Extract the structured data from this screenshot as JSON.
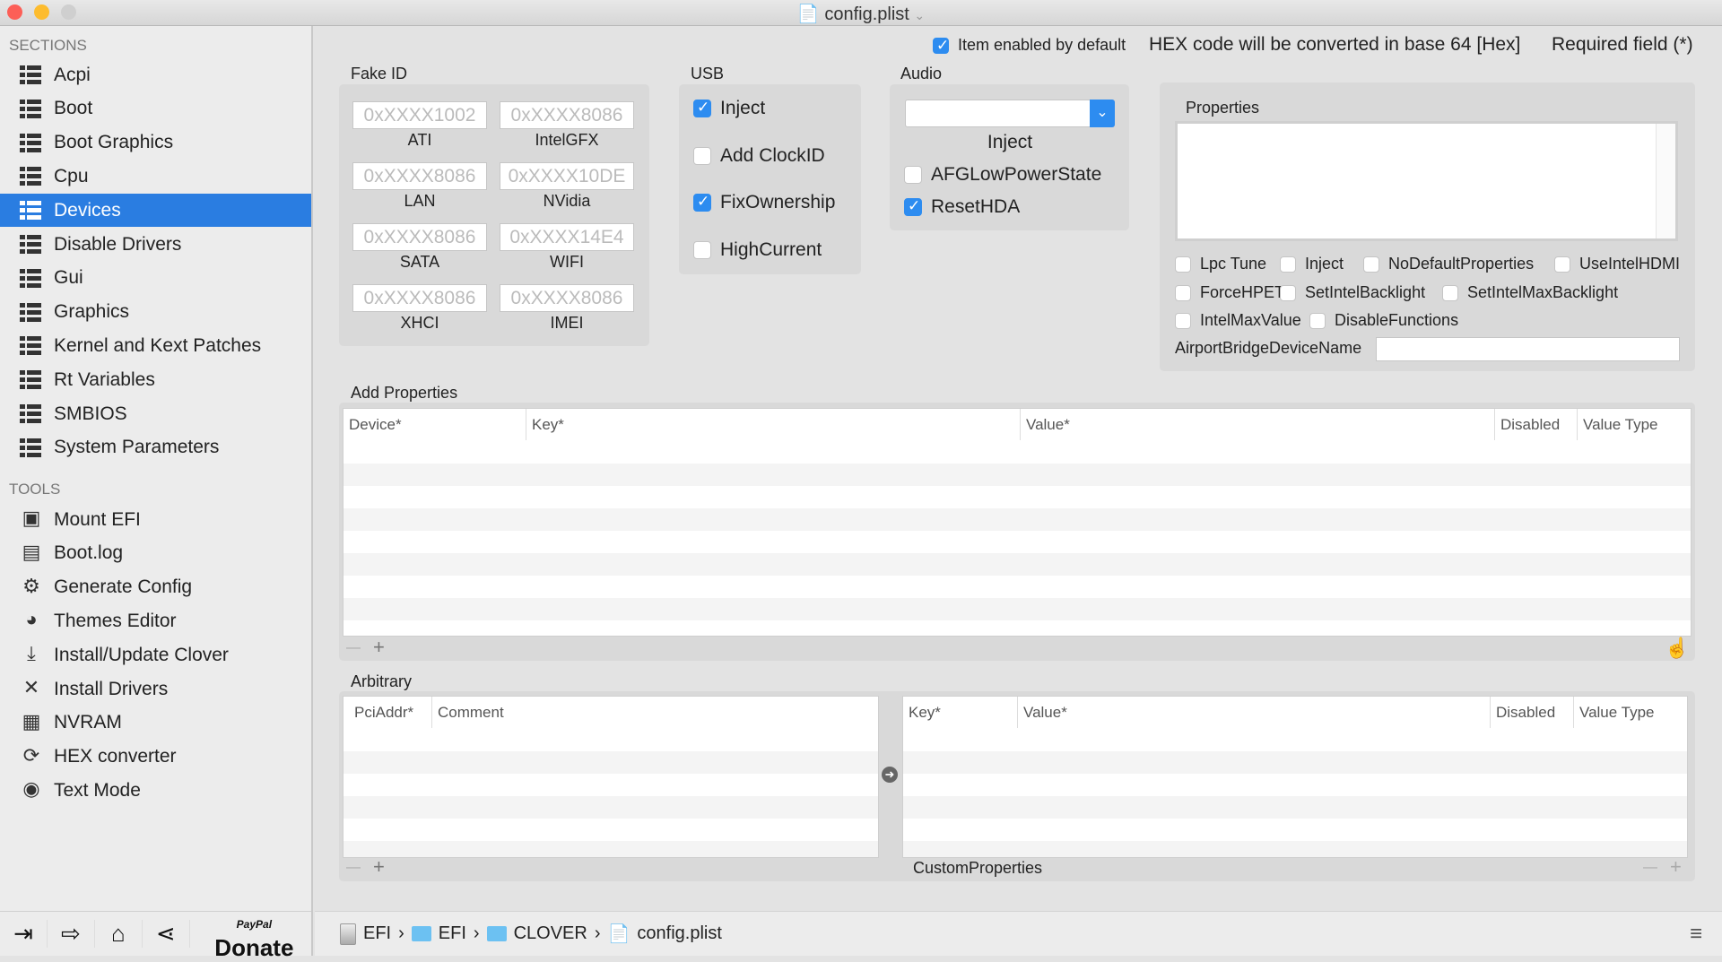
{
  "window": {
    "title": "config.plist"
  },
  "sidebar": {
    "sections_label": "SECTIONS",
    "sections": [
      "Acpi",
      "Boot",
      "Boot Graphics",
      "Cpu",
      "Devices",
      "Disable Drivers",
      "Gui",
      "Graphics",
      "Kernel and Kext Patches",
      "Rt Variables",
      "SMBIOS",
      "System Parameters"
    ],
    "selected": "Devices",
    "tools_label": "TOOLS",
    "tools": [
      {
        "label": "Mount EFI",
        "icon": "disk-icon",
        "g": "▣"
      },
      {
        "label": "Boot.log",
        "icon": "log-icon",
        "g": "▤"
      },
      {
        "label": "Generate Config",
        "icon": "gear-icon",
        "g": "⚙"
      },
      {
        "label": "Themes Editor",
        "icon": "palette-icon",
        "g": "◕"
      },
      {
        "label": "Install/Update Clover",
        "icon": "download-icon",
        "g": "⤓"
      },
      {
        "label": "Install Drivers",
        "icon": "tools-icon",
        "g": "✕"
      },
      {
        "label": "NVRAM",
        "icon": "chip-icon",
        "g": "▦"
      },
      {
        "label": "HEX converter",
        "icon": "refresh-icon",
        "g": "⟳"
      },
      {
        "label": "Text Mode",
        "icon": "eye-icon",
        "g": "◉"
      }
    ],
    "donate": "Donate",
    "paypal": "PayPal"
  },
  "header": {
    "item_enabled": "Item enabled by default",
    "hex_note": "HEX code will be converted in base 64 [Hex]",
    "required": "Required field (*)"
  },
  "fake_id": {
    "title": "Fake ID",
    "fields": [
      {
        "label": "ATI",
        "placeholder": "0xXXXX1002"
      },
      {
        "label": "IntelGFX",
        "placeholder": "0xXXXX8086"
      },
      {
        "label": "LAN",
        "placeholder": "0xXXXX8086"
      },
      {
        "label": "NVidia",
        "placeholder": "0xXXXX10DE"
      },
      {
        "label": "SATA",
        "placeholder": "0xXXXX8086"
      },
      {
        "label": "WIFI",
        "placeholder": "0xXXXX14E4"
      },
      {
        "label": "XHCI",
        "placeholder": "0xXXXX8086"
      },
      {
        "label": "IMEI",
        "placeholder": "0xXXXX8086"
      }
    ]
  },
  "usb": {
    "title": "USB",
    "options": [
      {
        "label": "Inject",
        "checked": true
      },
      {
        "label": "Add ClockID",
        "checked": false
      },
      {
        "label": "FixOwnership",
        "checked": true
      },
      {
        "label": "HighCurrent",
        "checked": false
      }
    ]
  },
  "audio": {
    "title": "Audio",
    "inject_value": "",
    "inject_label": "Inject",
    "options": [
      {
        "label": "AFGLowPowerState",
        "checked": false
      },
      {
        "label": "ResetHDA",
        "checked": true
      }
    ]
  },
  "properties": {
    "title": "Properties",
    "options": [
      {
        "label": "Lpc Tune"
      },
      {
        "label": "Inject"
      },
      {
        "label": "NoDefaultProperties"
      },
      {
        "label": "UseIntelHDMI"
      },
      {
        "label": "ForceHPET"
      },
      {
        "label": "SetIntelBacklight"
      },
      {
        "label": "SetIntelMaxBacklight"
      },
      {
        "label": "IntelMaxValue"
      },
      {
        "label": "DisableFunctions"
      }
    ],
    "airport_label": "AirportBridgeDeviceName",
    "airport_value": ""
  },
  "add_properties": {
    "title": "Add Properties",
    "columns": [
      "Device*",
      "Key*",
      "Value*",
      "Disabled",
      "Value Type"
    ],
    "rows": []
  },
  "arbitrary": {
    "title": "Arbitrary",
    "left_columns": [
      "PciAddr*",
      "Comment"
    ],
    "right_columns": [
      "Key*",
      "Value*",
      "Disabled",
      "Value Type"
    ],
    "custom_label": "CustomProperties"
  },
  "footer_controls": {
    "minus": "—",
    "plus": "+"
  },
  "breadcrumb": [
    "EFI",
    "EFI",
    "CLOVER",
    "config.plist"
  ],
  "colors": {
    "accent": "#2a7de1",
    "checkbox": "#2d8cf0"
  }
}
